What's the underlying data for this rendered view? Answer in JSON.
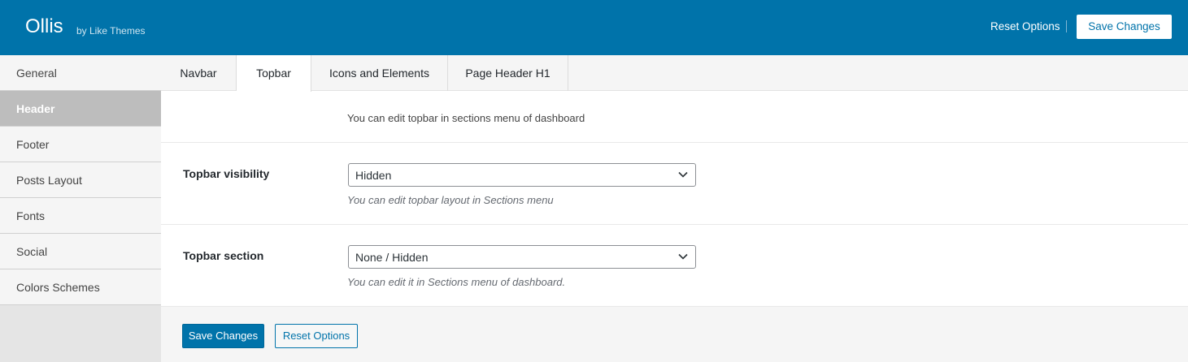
{
  "header": {
    "title": "Ollis",
    "byline": "by Like Themes",
    "reset_label": "Reset Options",
    "save_label": "Save Changes"
  },
  "sidebar": {
    "items": [
      {
        "label": "General",
        "active": false
      },
      {
        "label": "Header",
        "active": true
      },
      {
        "label": "Footer",
        "active": false
      },
      {
        "label": "Posts Layout",
        "active": false
      },
      {
        "label": "Fonts",
        "active": false
      },
      {
        "label": "Social",
        "active": false
      },
      {
        "label": "Colors Schemes",
        "active": false
      }
    ]
  },
  "tabs": [
    {
      "label": "Navbar",
      "active": false
    },
    {
      "label": "Topbar",
      "active": true
    },
    {
      "label": "Icons and Elements",
      "active": false
    },
    {
      "label": "Page Header H1",
      "active": false
    }
  ],
  "main": {
    "note": "You can edit topbar in sections menu of dashboard",
    "fields": [
      {
        "label": "Topbar visibility",
        "value": "Hidden",
        "description": "You can edit topbar layout in Sections menu"
      },
      {
        "label": "Topbar section",
        "value": "None / Hidden",
        "description": "You can edit it in Sections menu of dashboard."
      }
    ]
  },
  "footer": {
    "save_label": "Save Changes",
    "reset_label": "Reset Options"
  },
  "colors": {
    "brand": "#0073aa",
    "sidebar_active": "#bdbdbd"
  }
}
